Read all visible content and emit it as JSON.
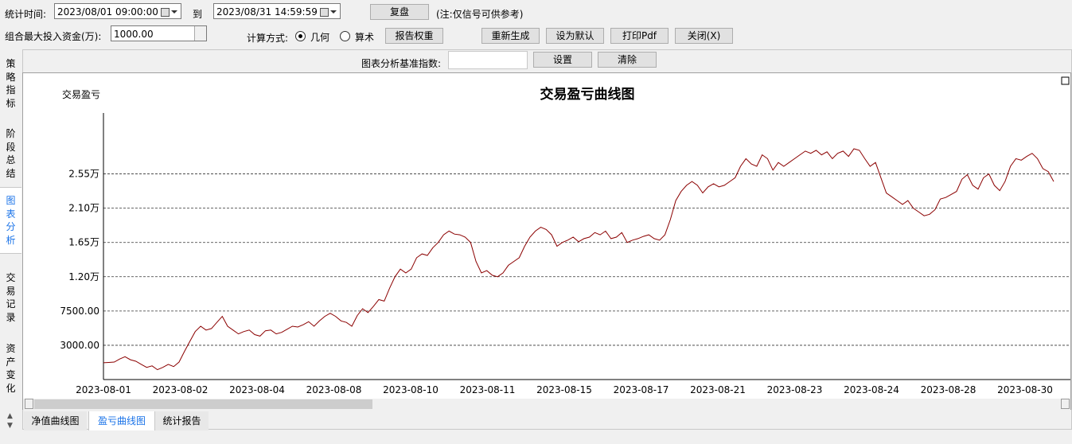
{
  "toolbar": {
    "stat_time_label": "统计时间:",
    "start_time": "2023/08/01 09:00:00",
    "to_label": "到",
    "end_time": "2023/08/31 14:59:59",
    "replay_button": "复盘",
    "note": "(注:仅信号可供参考)",
    "max_capital_label": "组合最大投入资金(万):",
    "max_capital_value": "1000.00",
    "calc_method_label": "计算方式:",
    "radio_geometric": "几何",
    "radio_arithmetic": "算术",
    "report_weight_button": "报告权重",
    "regenerate_button": "重新生成",
    "set_default_button": "设为默认",
    "print_pdf_button": "打印Pdf",
    "close_button": "关闭(X)"
  },
  "benchmark": {
    "label": "图表分析基准指数:",
    "value": "",
    "set_button": "设置",
    "clear_button": "清除"
  },
  "side_tabs": [
    {
      "label": "策略指标",
      "active": false
    },
    {
      "label": "阶段总结",
      "active": false
    },
    {
      "label": "图表分析",
      "active": true
    },
    {
      "label": "交易记录",
      "active": false
    },
    {
      "label": "资产变化",
      "active": false
    }
  ],
  "bottom_tabs": [
    {
      "label": "净值曲线图",
      "active": false
    },
    {
      "label": "盈亏曲线图",
      "active": true
    },
    {
      "label": "统计报告",
      "active": false
    }
  ],
  "colors": {
    "line": "#8b0000",
    "active_tab": "#1a73e8"
  },
  "chart_data": {
    "type": "line",
    "title": "交易盈亏曲线图",
    "ylabel": "交易盈亏",
    "ylim": [
      -1500,
      33500
    ],
    "y_ticks": [
      3000,
      7500,
      12000,
      16500,
      21000,
      25500
    ],
    "y_tick_labels": [
      "3000.00",
      "7500.00",
      "1.20万",
      "1.65万",
      "2.10万",
      "2.55万"
    ],
    "x_tick_labels": [
      "2023-08-01",
      "2023-08-02",
      "2023-08-04",
      "2023-08-08",
      "2023-08-10",
      "2023-08-11",
      "2023-08-15",
      "2023-08-17",
      "2023-08-21",
      "2023-08-23",
      "2023-08-24",
      "2023-08-28",
      "2023-08-30"
    ],
    "grid": "horizontal dashed",
    "series": [
      {
        "values": [
          700,
          750,
          800,
          1200,
          1500,
          1100,
          900,
          500,
          100,
          300,
          -200,
          100,
          500,
          200,
          800,
          2200,
          3500,
          4800,
          5500,
          5000,
          5200,
          6000,
          6800,
          5500,
          5000,
          4500,
          4800,
          5000,
          4400,
          4200,
          4900,
          5000,
          4500,
          4700,
          5100,
          5500,
          5400,
          5700,
          6100,
          5500,
          6200,
          6800,
          7200,
          6800,
          6200,
          6000,
          5500,
          6900,
          7800,
          7300,
          8100,
          9000,
          8800,
          10500,
          12000,
          13000,
          12500,
          13000,
          14500,
          15000,
          14800,
          15800,
          16500,
          17500,
          18000,
          17600,
          17500,
          17200,
          16500,
          14000,
          12500,
          12800,
          12200,
          12000,
          12500,
          13500,
          14000,
          14500,
          16000,
          17200,
          18000,
          18500,
          18200,
          17500,
          16000,
          16500,
          16800,
          17200,
          16600,
          17000,
          17200,
          17800,
          17500,
          18000,
          17000,
          17200,
          17800,
          16500,
          16800,
          17000,
          17300,
          17500,
          17000,
          16800,
          17500,
          19500,
          22000,
          23200,
          24000,
          24500,
          24000,
          23000,
          23800,
          24200,
          23800,
          24000,
          24500,
          25000,
          26500,
          27500,
          26800,
          26500,
          28000,
          27500,
          26000,
          27000,
          26500,
          27000,
          27500,
          28000,
          28500,
          28200,
          28600,
          28000,
          28400,
          27500,
          28200,
          28500,
          27800,
          28800,
          28600,
          27500,
          26500,
          27000,
          25000,
          23000,
          22500,
          22000,
          21500,
          22000,
          21000,
          20500,
          20000,
          20200,
          20800,
          22200,
          22400,
          22800,
          23200,
          24800,
          25400,
          24000,
          23500,
          25000,
          25500,
          24000,
          23300,
          24500,
          26500,
          27500,
          27300,
          27800,
          28200,
          27500,
          26200,
          25800,
          24500
        ]
      }
    ]
  }
}
